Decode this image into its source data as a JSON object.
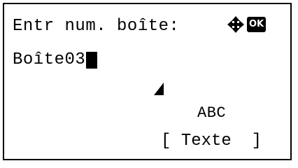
{
  "screen": {
    "title": "Entr num. boîte:",
    "input_value": "Boîte03",
    "mode": "ABC"
  },
  "keys": {
    "navigation_icon": "four-way-arrow-icon",
    "ok_label": "OK",
    "softkey_label": "Texte",
    "bracket_left": "[",
    "bracket_right": "]"
  }
}
